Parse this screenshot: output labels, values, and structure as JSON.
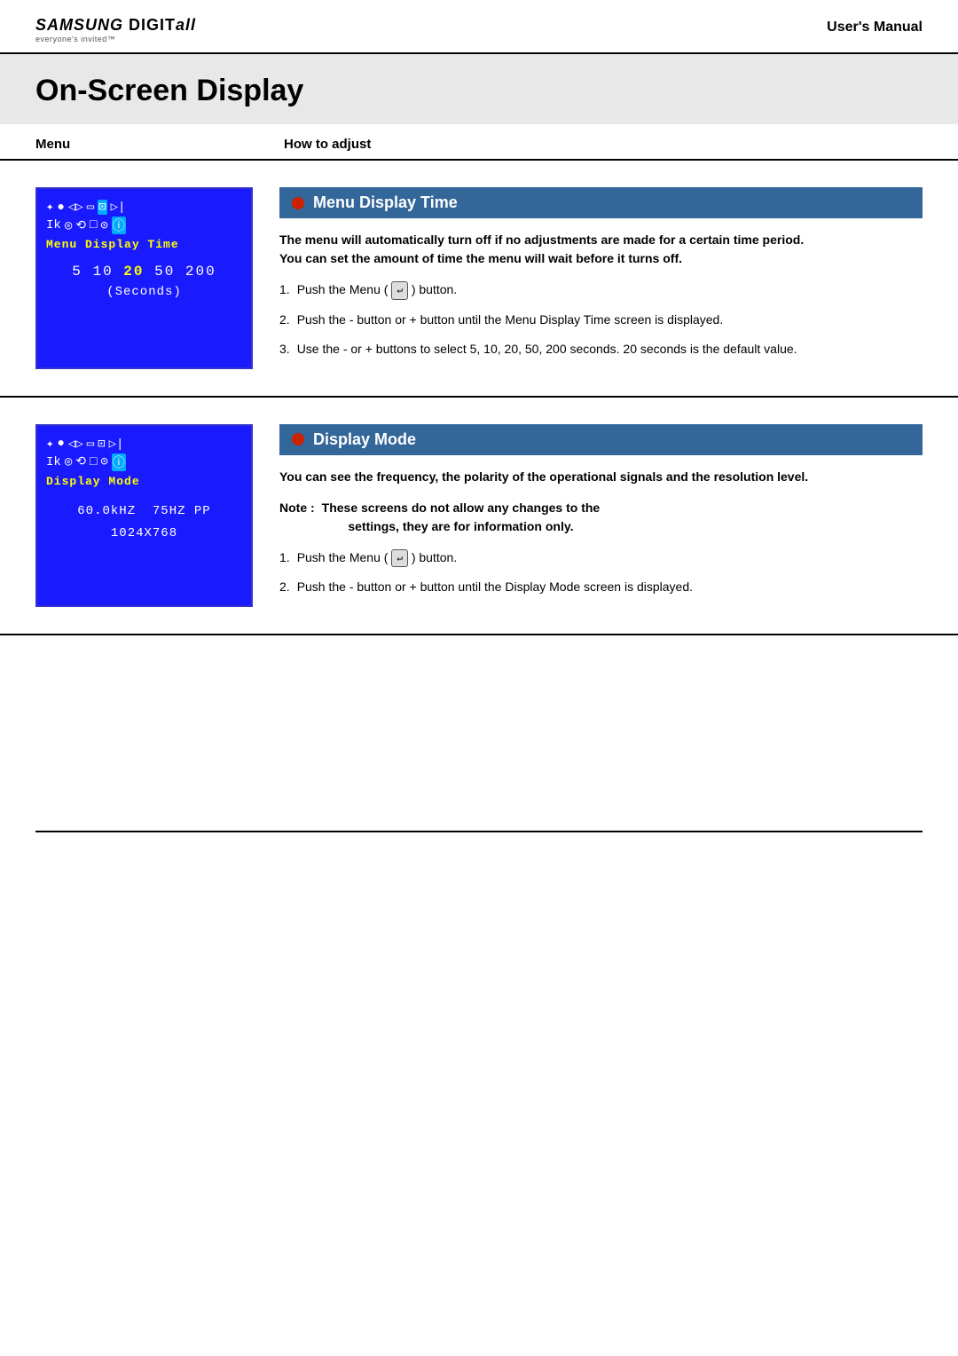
{
  "header": {
    "logo_main": "SAMSUNG DIGIT",
    "logo_suffix": "all",
    "logo_tagline": "everyone's invited™",
    "title": "User's Manual"
  },
  "page_title": "On-Screen Display",
  "col_headers": {
    "menu": "Menu",
    "how_to_adjust": "How to adjust"
  },
  "sections": [
    {
      "id": "menu-display-time",
      "osd_icons_row1": "☆  ●  ◁  ▭  ⬚  ▷◁",
      "osd_icons_row2": "Ik  ◎  ◎  □  ⊙  ⓘ",
      "osd_label": "Menu Display Time",
      "osd_values_parts": [
        "5  10  ",
        "20",
        "  50  200"
      ],
      "osd_sub": "(Seconds)",
      "title": "Menu Display Time",
      "desc": "The menu will automatically turn off if no adjustments are made for a certain time period.\nYou can set the amount of time the menu will wait before it turns off.",
      "steps": [
        {
          "num": "1.",
          "text": "Push the Menu ( ↵ ) button."
        },
        {
          "num": "2.",
          "text": "Push the - button or + button until the Menu Display Time screen is displayed."
        },
        {
          "num": "3.",
          "text": "Use the - or + buttons to select 5, 10, 20, 50, 200 seconds. 20 seconds is the default value."
        }
      ]
    },
    {
      "id": "display-mode",
      "osd_icons_row1": "☆  ●  ◁  ▭  ⬚  ▷◁",
      "osd_icons_row2": "Ik  ◎  ◎  □  ⊙  ⓘ",
      "osd_label": "Display Mode",
      "osd_display_values": "60.0kHZ  75HZ PP\n1024X768",
      "title": "Display Mode",
      "desc": "You can see the frequency, the polarity of the operational signals and the resolution level.",
      "note": "Note :  These screens do not allow any changes to the\n           settings, they are for information only.",
      "steps": [
        {
          "num": "1.",
          "text": "Push the Menu ( ↵ ) button."
        },
        {
          "num": "2.",
          "text": "Push the - button or + button until the Display Mode screen is displayed."
        }
      ]
    }
  ]
}
